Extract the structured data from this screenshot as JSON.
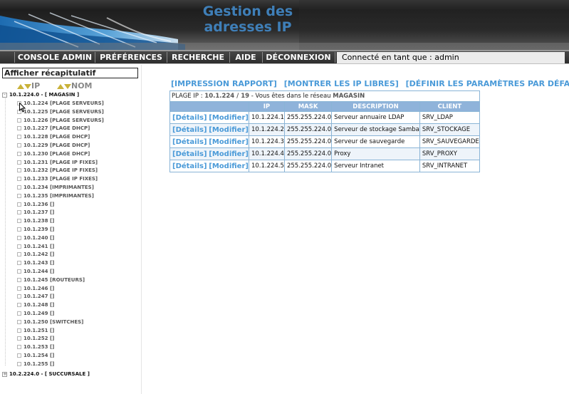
{
  "banner": {
    "title_line1": "Gestion des",
    "title_line2": "adresses IP"
  },
  "menu": {
    "items": [
      {
        "label": "CONSOLE ADMIN"
      },
      {
        "label": "PRÉFÉRENCES"
      },
      {
        "label": "RECHERCHE"
      },
      {
        "label": "AIDE"
      },
      {
        "label": "DÉCONNEXION"
      }
    ],
    "connected_label": "Connecté en tant que : admin"
  },
  "sidebar": {
    "summary_label": "Afficher récapitulatif",
    "sort_ip_label": "IP",
    "sort_nom_label": "NOM",
    "root1_expander": "-",
    "root1_label": "10.1.224.0 - [ MAGASIN ]",
    "root2_expander": "+",
    "root2_label": "10.2.224.0 - [ SUCCURSALE ]",
    "items": [
      "10.1.224 [PLAGE SERVEURS]",
      "10.1.225 [PLAGE SERVEURS]",
      "10.1.226 [PLAGE SERVEURS]",
      "10.1.227 [PLAGE DHCP]",
      "10.1.228 [PLAGE DHCP]",
      "10.1.229 [PLAGE DHCP]",
      "10.1.230 [PLAGE DHCP]",
      "10.1.231 [PLAGE IP FIXES]",
      "10.1.232 [PLAGE IP FIXES]",
      "10.1.233 [PLAGE IP FIXES]",
      "10.1.234 [IMPRIMANTES]",
      "10.1.235 [IMPRIMANTES]",
      "10.1.236 []",
      "10.1.237 []",
      "10.1.238 []",
      "10.1.239 []",
      "10.1.240 []",
      "10.1.241 []",
      "10.1.242 []",
      "10.1.243 []",
      "10.1.244 []",
      "10.1.245 [ROUTEURS]",
      "10.1.246 []",
      "10.1.247 []",
      "10.1.248 []",
      "10.1.249 []",
      "10.1.250 [SWITCHES]",
      "10.1.251 []",
      "10.1.252 []",
      "10.1.253 []",
      "10.1.254 []",
      "10.1.255 []"
    ]
  },
  "main": {
    "actions": {
      "report": "[IMPRESSION RAPPORT]",
      "free_ips": "[MONTRER LES IP LIBRES]",
      "defaults": "[DÉFINIR LES PARAMÈTRES PAR DÉFAUT]"
    },
    "plage": {
      "prefix": "PLAGE IP : ",
      "range": "10.1.224 / 19",
      "middle": " - Vous êtes dans le réseau ",
      "network": "MAGASIN"
    },
    "table": {
      "headers": [
        "",
        "IP",
        "MASK",
        "DESCRIPTION",
        "CLIENT"
      ],
      "details_label": "[Détails]",
      "modify_label": "[Modifier]",
      "rows": [
        {
          "ip": "10.1.224.1",
          "mask": "255.255.224.0",
          "description": "Serveur annuaire LDAP",
          "client": "SRV_LDAP"
        },
        {
          "ip": "10.1.224.2",
          "mask": "255.255.224.0",
          "description": "Serveur de stockage Samba",
          "client": "SRV_STOCKAGE"
        },
        {
          "ip": "10.1.224.3",
          "mask": "255.255.224.0",
          "description": "Serveur de sauvegarde",
          "client": "SRV_SAUVEGARDE"
        },
        {
          "ip": "10.1.224.4",
          "mask": "255.255.224.0",
          "description": "Proxy",
          "client": "SRV_PROXY"
        },
        {
          "ip": "10.1.224.5",
          "mask": "255.255.224.0",
          "description": "Serveur Intranet",
          "client": "SRV_INTRANET"
        }
      ]
    }
  }
}
